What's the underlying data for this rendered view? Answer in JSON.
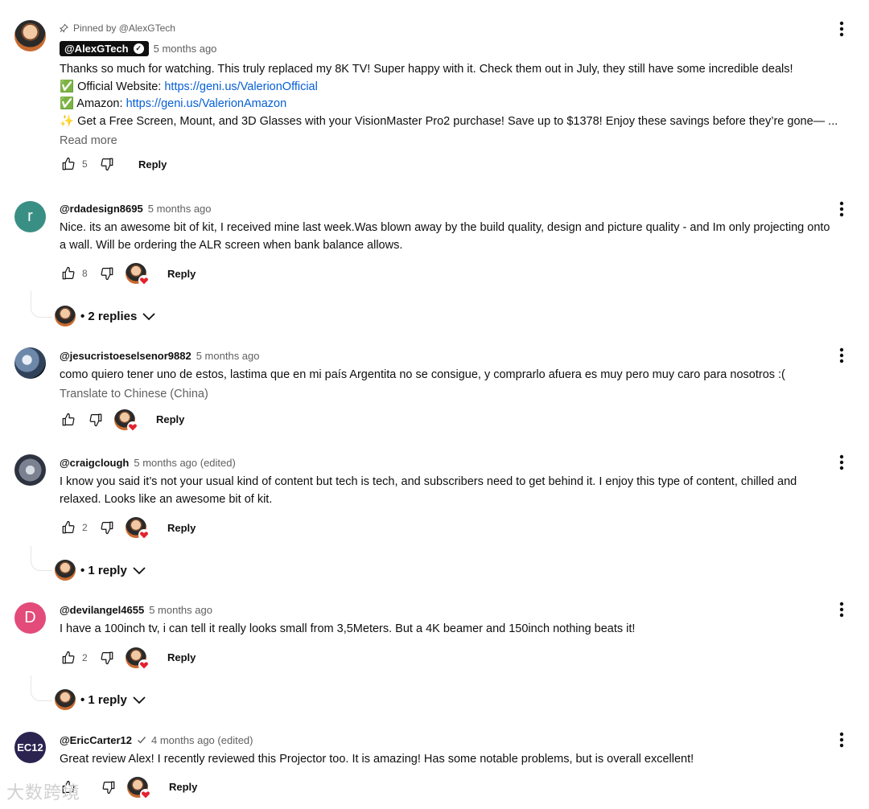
{
  "comments": [
    {
      "pinned_label": "Pinned by @AlexGTech",
      "handle": "@AlexGTech",
      "time": "5 months ago",
      "lines": [
        "Thanks so much for watching. This truly replaced my 8K TV! Super happy with it. Check them out in July, they still have some incredible deals!",
        "Official Website:",
        "https://geni.us/ValerionOfficial",
        "Amazon:",
        "https://geni.us/ValerionAmazon",
        "Get a Free Screen, Mount, and 3D Glasses with your VisionMaster Pro2 purchase! Save up to $1378! Enjoy these savings before they’re gone— ..."
      ],
      "read_more": "Read more",
      "likes": "5",
      "reply": "Reply"
    },
    {
      "avatar_letter": "r",
      "handle": "@rdadesign8695",
      "time": "5 months ago",
      "text": "Nice. its an awesome bit of kit, I received mine last week.Was blown away by the build quality, design and picture quality - and Im only projecting onto a wall. Will be ordering the ALR screen when bank balance allows.",
      "likes": "8",
      "reply": "Reply",
      "replies_label": "• 2 replies"
    },
    {
      "handle": "@jesucristoeselsenor9882",
      "time": "5 months ago",
      "text": "como quiero tener uno de estos, lastima que en mi país Argentita no se consigue, y comprarlo afuera es muy pero muy caro para nosotros :(",
      "translate": "Translate to Chinese (China)",
      "reply": "Reply"
    },
    {
      "handle": "@craigclough",
      "time": "5 months ago (edited)",
      "text": "I know you said it’s not your usual kind of content but tech is tech, and subscribers need to get behind it. I enjoy this type of content, chilled and relaxed.  Looks like an awesome bit of kit.",
      "likes": "2",
      "reply": "Reply",
      "replies_label": "• 1 reply"
    },
    {
      "avatar_letter": "D",
      "handle": "@devilangel4655",
      "time": "5 months ago",
      "text": "I have a 100inch tv, i can tell it really looks small from 3,5Meters. But a 4K beamer  and 150inch nothing beats it!",
      "likes": "2",
      "reply": "Reply",
      "replies_label": "• 1 reply"
    },
    {
      "avatar_text": "EC12",
      "handle": "@EricCarter12",
      "time": "4 months ago (edited)",
      "text": "Great review Alex! I recently reviewed this Projector too. It is amazing! Has some notable problems, but is overall excellent!",
      "reply": "Reply"
    }
  ],
  "watermark": "大数跨境"
}
